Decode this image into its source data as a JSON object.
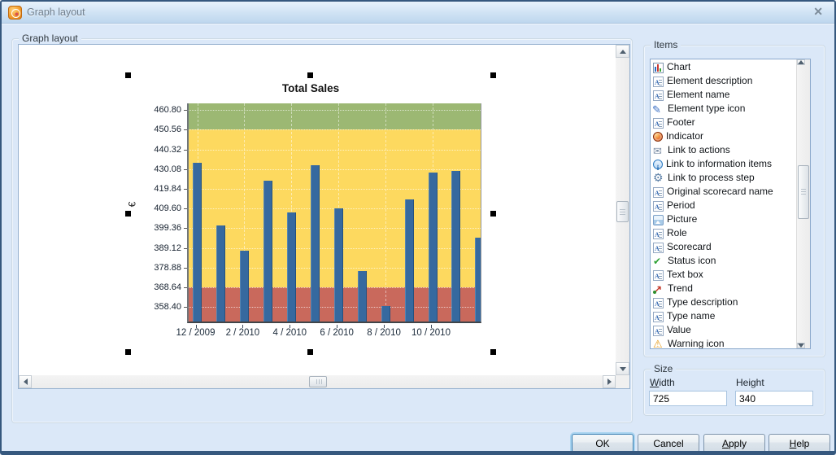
{
  "window": {
    "title": "Graph layout",
    "close_glyph": "✕"
  },
  "main_group": {
    "label": "Graph layout"
  },
  "items_panel": {
    "label": "Items",
    "list": [
      {
        "label": "Chart",
        "icon": "chart"
      },
      {
        "label": "Element description",
        "icon": "text"
      },
      {
        "label": "Element name",
        "icon": "text"
      },
      {
        "label": "Element type icon",
        "icon": "pencil"
      },
      {
        "label": "Footer",
        "icon": "text"
      },
      {
        "label": "Indicator",
        "icon": "indicator"
      },
      {
        "label": "Link to actions",
        "icon": "envelope"
      },
      {
        "label": "Link to information items",
        "icon": "info"
      },
      {
        "label": "Link to process step",
        "icon": "gear"
      },
      {
        "label": "Original scorecard name",
        "icon": "text"
      },
      {
        "label": "Period",
        "icon": "text"
      },
      {
        "label": "Picture",
        "icon": "picture"
      },
      {
        "label": "Role",
        "icon": "text"
      },
      {
        "label": "Scorecard",
        "icon": "text"
      },
      {
        "label": "Status icon",
        "icon": "check"
      },
      {
        "label": "Text box",
        "icon": "text"
      },
      {
        "label": "Trend",
        "icon": "trend"
      },
      {
        "label": "Type description",
        "icon": "text"
      },
      {
        "label": "Type name",
        "icon": "text"
      },
      {
        "label": "Value",
        "icon": "text"
      },
      {
        "label": "Warning icon",
        "icon": "warning"
      }
    ]
  },
  "size_panel": {
    "label": "Size",
    "width_label_u": "W",
    "width_label_rest": "idth",
    "width_value": "725",
    "height_label": "Height",
    "height_value": "340"
  },
  "buttons": {
    "ok": "OK",
    "cancel": "Cancel",
    "apply_u": "A",
    "apply_rest": "pply",
    "help_u": "H",
    "help_rest": "elp"
  },
  "chart_data": {
    "type": "bar",
    "title": "Total Sales",
    "y_axis_label": "€",
    "values": [
      433.5,
      401,
      387.5,
      424,
      407.5,
      432,
      409.5,
      377,
      359,
      414.5,
      428.5,
      429,
      394.5
    ],
    "x_tick_labels": [
      {
        "bar_index": 0,
        "label": "12 / 2009"
      },
      {
        "bar_index": 2,
        "label": "2 / 2010"
      },
      {
        "bar_index": 4,
        "label": "4 / 2010"
      },
      {
        "bar_index": 6,
        "label": "6 / 2010"
      },
      {
        "bar_index": 8,
        "label": "8 / 2010"
      },
      {
        "bar_index": 10,
        "label": "10 / 2010"
      }
    ],
    "y_ticks": [
      358.4,
      368.64,
      378.88,
      389.12,
      399.36,
      409.6,
      419.84,
      430.08,
      440.32,
      450.56,
      460.8
    ],
    "y_tick_decimals": 2,
    "ylim": [
      350.0,
      464.3
    ],
    "bands": [
      {
        "name": "red",
        "from": 350.0,
        "to": 368.64,
        "color": "#c9695c"
      },
      {
        "name": "yellow",
        "from": 368.64,
        "to": 450.56,
        "color": "#fdd95f"
      },
      {
        "name": "green",
        "from": 450.56,
        "to": 464.3,
        "color": "#9cb873"
      }
    ],
    "bar_color": "#36699f",
    "grid": true,
    "legend": false
  }
}
